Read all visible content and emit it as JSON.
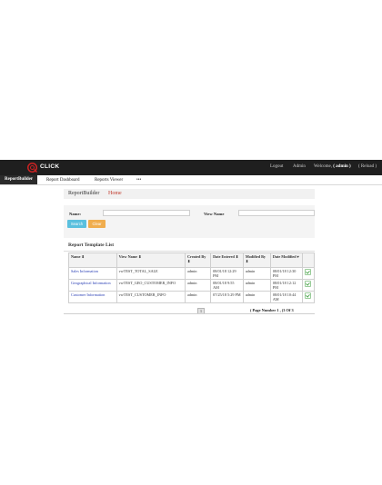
{
  "app": {
    "brand": "CLICK",
    "accent": "#cc2222"
  },
  "topnav": {
    "logout": "Logout",
    "admin": "Admin",
    "welcome_prefix": "Welcome,",
    "welcome_user": "( admin )",
    "reload": "( Reload )"
  },
  "navbar": {
    "tabs": [
      {
        "label": "ReportBuilder",
        "active": true
      },
      {
        "label": "Report Dashboard"
      },
      {
        "label": "Reports Viewer"
      },
      {
        "label": "•••"
      }
    ]
  },
  "breadcrumb": {
    "title": "ReportBuilder",
    "home": "Home"
  },
  "search": {
    "name_label": "Name:",
    "name_value": "",
    "view_label": "View Name",
    "view_value": "",
    "search_button": "Search",
    "clear_button": "Clear",
    "search_color": "#5bc0de",
    "clear_color": "#f0ad4e"
  },
  "list": {
    "title": "Report Template List",
    "columns": [
      "Name ⬍",
      "View Name ⬍",
      "Created By ⬍",
      "Date Entered ⬍",
      "Modified By ⬍",
      "Date Modified ▾",
      ""
    ],
    "rows": [
      {
        "name": "Sales Information",
        "view": "vwTEST_TOTAL_SALE",
        "created": "admin",
        "entered": "08/01/18 12:29 PM",
        "modified": "admin",
        "date_modified": "08/01/18 12:30 PM"
      },
      {
        "name": "Geographical Information",
        "view": "vwTEST_GEO_CUSTOMER_INFO",
        "created": "admin",
        "entered": "08/01/18 9:55 AM",
        "modified": "admin",
        "date_modified": "08/01/18 12:12 PM"
      },
      {
        "name": "Customer Information",
        "view": "vwTEST_CUSTOMER_INFO",
        "created": "admin",
        "entered": "07/25/18 5:29 PM",
        "modified": "admin",
        "date_modified": "08/01/18 10:44 AM"
      }
    ],
    "pager_button": "1",
    "page_text": "( Page Number 1 , (3 Of 3"
  }
}
